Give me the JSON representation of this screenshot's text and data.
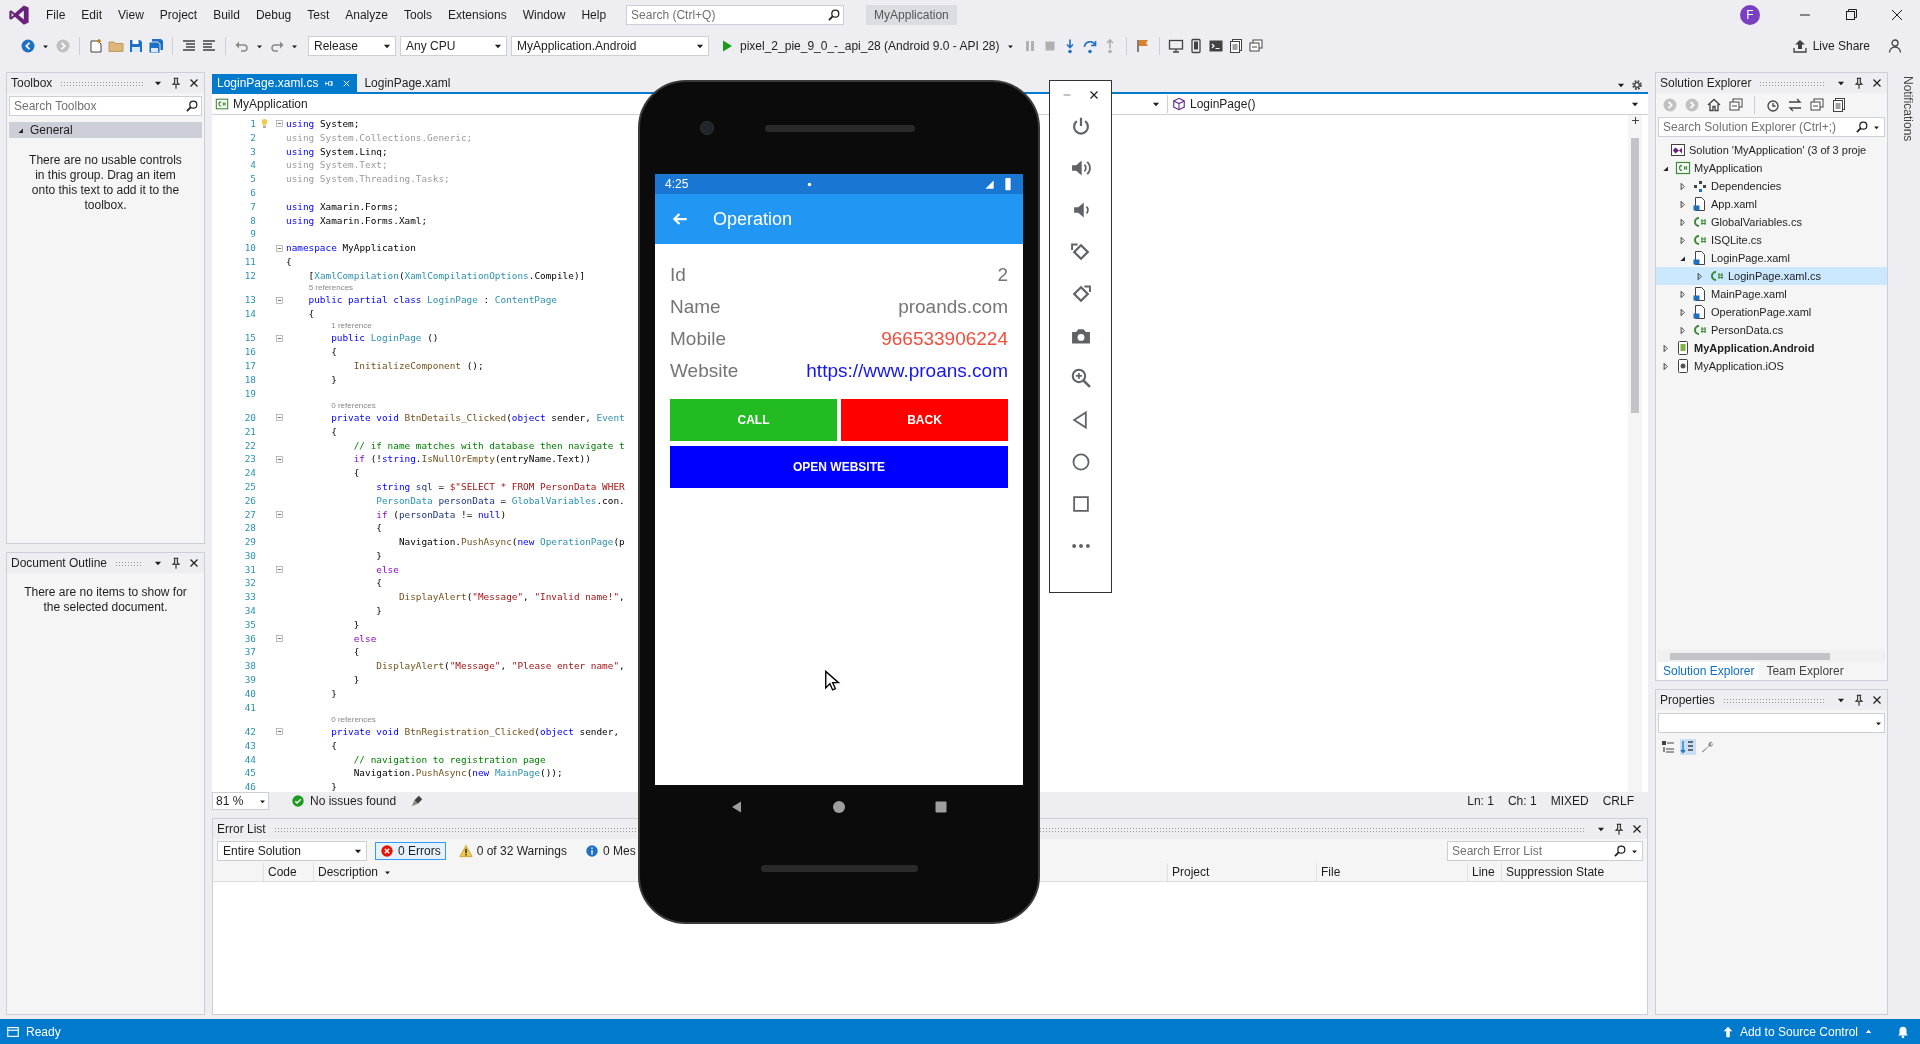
{
  "menu_bar": {
    "items": [
      "File",
      "Edit",
      "View",
      "Project",
      "Build",
      "Debug",
      "Test",
      "Analyze",
      "Tools",
      "Extensions",
      "Window",
      "Help"
    ],
    "search": {
      "placeholder": "Search (Ctrl+Q)"
    },
    "solution_name": "MyApplication",
    "avatar": "F"
  },
  "toolbar": {
    "configuration": "Release",
    "platform": "Any CPU",
    "startup_project": "MyApplication.Android",
    "run_target": "pixel_2_pie_9_0_-_api_28 (Android 9.0 - API 28)",
    "live_share": "Live Share"
  },
  "toolbox": {
    "title": "Toolbox",
    "search": {
      "placeholder": "Search Toolbox"
    },
    "groups": [
      {
        "label": "General",
        "expanded": true
      }
    ],
    "message": "There are no usable controls in this group. Drag an item onto this text to add it to the toolbox."
  },
  "document_outline": {
    "title": "Document Outline",
    "message": "There are no items to show for the selected document."
  },
  "editor": {
    "tabs": [
      {
        "label": "LoginPage.xaml.cs",
        "selected": true
      },
      {
        "label": "LoginPage.xaml",
        "selected": false
      }
    ],
    "project": "MyApplication",
    "member": "LoginPage()",
    "lines": [
      {
        "kind": "code",
        "number": "1",
        "fold": true,
        "hint": true,
        "tokens": [
          {
            "kind": "kw",
            "text": "using"
          },
          {
            "kind": "p",
            "text": " System;"
          }
        ]
      },
      {
        "kind": "code",
        "number": "2",
        "fold": false,
        "hint": false,
        "tokens": [
          {
            "kind": "fd",
            "text": "using System.Collections.Generic;"
          }
        ]
      },
      {
        "kind": "code",
        "number": "3",
        "fold": false,
        "hint": false,
        "tokens": [
          {
            "kind": "kw",
            "text": "using"
          },
          {
            "kind": "p",
            "text": " System.Linq;"
          }
        ]
      },
      {
        "kind": "code",
        "number": "4",
        "fold": false,
        "hint": false,
        "tokens": [
          {
            "kind": "fd",
            "text": "using System.Text;"
          }
        ]
      },
      {
        "kind": "code",
        "number": "5",
        "fold": false,
        "hint": false,
        "tokens": [
          {
            "kind": "fd",
            "text": "using System.Threading.Tasks;"
          }
        ]
      },
      {
        "kind": "code",
        "number": "6",
        "fold": false,
        "hint": false
      },
      {
        "kind": "code",
        "number": "7",
        "fold": false,
        "hint": false,
        "tokens": [
          {
            "kind": "kw",
            "text": "using"
          },
          {
            "kind": "p",
            "text": " Xamarin.Forms;"
          }
        ]
      },
      {
        "kind": "code",
        "number": "8",
        "fold": false,
        "hint": false,
        "tokens": [
          {
            "kind": "kw",
            "text": "using"
          },
          {
            "kind": "p",
            "text": " Xamarin.Forms.Xaml;"
          }
        ]
      },
      {
        "kind": "code",
        "number": "9",
        "fold": false,
        "hint": false
      },
      {
        "kind": "code",
        "number": "10",
        "fold": true,
        "hint": false,
        "tokens": [
          {
            "kind": "kw",
            "text": "namespace"
          },
          {
            "kind": "p",
            "text": " MyApplication"
          }
        ]
      },
      {
        "kind": "code",
        "number": "11",
        "fold": false,
        "hint": false,
        "tokens": [
          {
            "kind": "p",
            "text": "{"
          }
        ]
      },
      {
        "kind": "code",
        "number": "12",
        "fold": false,
        "hint": false,
        "tokens": [
          {
            "kind": "p",
            "text": "    ["
          },
          {
            "kind": "ty",
            "text": "XamlCompilation"
          },
          {
            "kind": "p",
            "text": "("
          },
          {
            "kind": "ty",
            "text": "XamlCompilationOptions"
          },
          {
            "kind": "p",
            "text": ".Compile)]"
          }
        ]
      },
      {
        "kind": "lens",
        "text": "5 references"
      },
      {
        "kind": "code",
        "number": "13",
        "fold": true,
        "hint": false,
        "tokens": [
          {
            "kind": "kw",
            "text": "    public partial class"
          },
          {
            "kind": "ty",
            "text": " LoginPage"
          },
          {
            "kind": "p",
            "text": " : "
          },
          {
            "kind": "ty",
            "text": "ContentPage"
          }
        ]
      },
      {
        "kind": "code",
        "number": "14",
        "fold": false,
        "hint": false,
        "tokens": [
          {
            "kind": "p",
            "text": "    {"
          }
        ]
      },
      {
        "kind": "lens",
        "text": "1 reference"
      },
      {
        "kind": "code",
        "number": "15",
        "fold": true,
        "hint": false,
        "tokens": [
          {
            "kind": "kw",
            "text": "        public"
          },
          {
            "kind": "ty",
            "text": " LoginPage"
          },
          {
            "kind": "p",
            "text": " ()"
          }
        ]
      },
      {
        "kind": "code",
        "number": "16",
        "fold": false,
        "hint": false,
        "tokens": [
          {
            "kind": "p",
            "text": "        {"
          }
        ]
      },
      {
        "kind": "code",
        "number": "17",
        "fold": false,
        "hint": false,
        "tokens": [
          {
            "kind": "me",
            "text": "            InitializeComponent"
          },
          {
            "kind": "p",
            "text": " ();"
          }
        ]
      },
      {
        "kind": "code",
        "number": "18",
        "fold": false,
        "hint": false,
        "tokens": [
          {
            "kind": "p",
            "text": "        }"
          }
        ]
      },
      {
        "kind": "code",
        "number": "19",
        "fold": false,
        "hint": false
      },
      {
        "kind": "lens",
        "text": "0 references"
      },
      {
        "kind": "code",
        "number": "20",
        "fold": true,
        "hint": false,
        "tokens": [
          {
            "kind": "kw",
            "text": "        private void"
          },
          {
            "kind": "me",
            "text": " BtnDetails_Clicked"
          },
          {
            "kind": "p",
            "text": "("
          },
          {
            "kind": "kw",
            "text": "object"
          },
          {
            "kind": "p",
            "text": " sender, "
          },
          {
            "kind": "ty",
            "text": "Event"
          }
        ]
      },
      {
        "kind": "code",
        "number": "21",
        "fold": false,
        "hint": false,
        "tokens": [
          {
            "kind": "p",
            "text": "        {"
          }
        ]
      },
      {
        "kind": "code",
        "number": "22",
        "fold": false,
        "hint": false,
        "tokens": [
          {
            "kind": "cm",
            "text": "            // if name matches with database then navigate t"
          }
        ]
      },
      {
        "kind": "code",
        "number": "23",
        "fold": true,
        "hint": false,
        "tokens": [
          {
            "kind": "ct",
            "text": "            if"
          },
          {
            "kind": "p",
            "text": " (!"
          },
          {
            "kind": "kw",
            "text": "string"
          },
          {
            "kind": "p",
            "text": "."
          },
          {
            "kind": "me",
            "text": "IsNullOrEmpty"
          },
          {
            "kind": "p",
            "text": "(entryName.Text))"
          }
        ]
      },
      {
        "kind": "code",
        "number": "24",
        "fold": false,
        "hint": false,
        "tokens": [
          {
            "kind": "p",
            "text": "            {"
          }
        ]
      },
      {
        "kind": "code",
        "number": "25",
        "fold": false,
        "hint": false,
        "tokens": [
          {
            "kind": "kw",
            "text": "                string"
          },
          {
            "kind": "va",
            "text": " sql"
          },
          {
            "kind": "p",
            "text": " = "
          },
          {
            "kind": "st",
            "text": "$\"SELECT * FROM PersonData WHER"
          }
        ]
      },
      {
        "kind": "code",
        "number": "26",
        "fold": false,
        "hint": false,
        "tokens": [
          {
            "kind": "ty",
            "text": "                PersonData"
          },
          {
            "kind": "va",
            "text": " personData"
          },
          {
            "kind": "p",
            "text": " = "
          },
          {
            "kind": "ty",
            "text": "GlobalVariables"
          },
          {
            "kind": "p",
            "text": ".con."
          }
        ]
      },
      {
        "kind": "code",
        "number": "27",
        "fold": true,
        "hint": false,
        "tokens": [
          {
            "kind": "ct",
            "text": "                if"
          },
          {
            "kind": "p",
            "text": " ("
          },
          {
            "kind": "va",
            "text": "personData"
          },
          {
            "kind": "p",
            "text": " != "
          },
          {
            "kind": "kw",
            "text": "null"
          },
          {
            "kind": "p",
            "text": ")"
          }
        ]
      },
      {
        "kind": "code",
        "number": "28",
        "fold": false,
        "hint": false,
        "tokens": [
          {
            "kind": "p",
            "text": "                {"
          }
        ]
      },
      {
        "kind": "code",
        "number": "29",
        "fold": false,
        "hint": false,
        "tokens": [
          {
            "kind": "p",
            "text": "                    Navigation."
          },
          {
            "kind": "me",
            "text": "PushAsync"
          },
          {
            "kind": "p",
            "text": "("
          },
          {
            "kind": "kw",
            "text": "new"
          },
          {
            "kind": "ty",
            "text": " OperationPage"
          },
          {
            "kind": "p",
            "text": "(p"
          }
        ]
      },
      {
        "kind": "code",
        "number": "30",
        "fold": false,
        "hint": false,
        "tokens": [
          {
            "kind": "p",
            "text": "                }"
          }
        ]
      },
      {
        "kind": "code",
        "number": "31",
        "fold": true,
        "hint": false,
        "tokens": [
          {
            "kind": "ct",
            "text": "                else"
          }
        ]
      },
      {
        "kind": "code",
        "number": "32",
        "fold": false,
        "hint": false,
        "tokens": [
          {
            "kind": "p",
            "text": "                {"
          }
        ]
      },
      {
        "kind": "code",
        "number": "33",
        "fold": false,
        "hint": false,
        "tokens": [
          {
            "kind": "me",
            "text": "                    DisplayAlert"
          },
          {
            "kind": "p",
            "text": "("
          },
          {
            "kind": "st",
            "text": "\"Message\""
          },
          {
            "kind": "p",
            "text": ", "
          },
          {
            "kind": "st",
            "text": "\"Invalid name!\""
          },
          {
            "kind": "p",
            "text": ","
          }
        ]
      },
      {
        "kind": "code",
        "number": "34",
        "fold": false,
        "hint": false,
        "tokens": [
          {
            "kind": "p",
            "text": "                }"
          }
        ]
      },
      {
        "kind": "code",
        "number": "35",
        "fold": false,
        "hint": false,
        "tokens": [
          {
            "kind": "p",
            "text": "            }"
          }
        ]
      },
      {
        "kind": "code",
        "number": "36",
        "fold": true,
        "hint": false,
        "tokens": [
          {
            "kind": "ct",
            "text": "            else"
          }
        ]
      },
      {
        "kind": "code",
        "number": "37",
        "fold": false,
        "hint": false,
        "tokens": [
          {
            "kind": "p",
            "text": "            {"
          }
        ]
      },
      {
        "kind": "code",
        "number": "38",
        "fold": false,
        "hint": false,
        "tokens": [
          {
            "kind": "me",
            "text": "                DisplayAlert"
          },
          {
            "kind": "p",
            "text": "("
          },
          {
            "kind": "st",
            "text": "\"Message\""
          },
          {
            "kind": "p",
            "text": ", "
          },
          {
            "kind": "st",
            "text": "\"Please enter name\""
          },
          {
            "kind": "p",
            "text": ","
          }
        ]
      },
      {
        "kind": "code",
        "number": "39",
        "fold": false,
        "hint": false,
        "tokens": [
          {
            "kind": "p",
            "text": "            }"
          }
        ]
      },
      {
        "kind": "code",
        "number": "40",
        "fold": false,
        "hint": false,
        "tokens": [
          {
            "kind": "p",
            "text": "        }"
          }
        ]
      },
      {
        "kind": "code",
        "number": "41",
        "fold": false,
        "hint": false
      },
      {
        "kind": "lens",
        "text": "0 references"
      },
      {
        "kind": "code",
        "number": "42",
        "fold": true,
        "hint": false,
        "tokens": [
          {
            "kind": "kw",
            "text": "        private void"
          },
          {
            "kind": "me",
            "text": " BtnRegistration_Clicked"
          },
          {
            "kind": "p",
            "text": "("
          },
          {
            "kind": "kw",
            "text": "object"
          },
          {
            "kind": "p",
            "text": " sender,"
          }
        ]
      },
      {
        "kind": "code",
        "number": "43",
        "fold": false,
        "hint": false,
        "tokens": [
          {
            "kind": "p",
            "text": "        {"
          }
        ]
      },
      {
        "kind": "code",
        "number": "44",
        "fold": false,
        "hint": false,
        "tokens": [
          {
            "kind": "cm",
            "text": "            // navigation to registration page"
          }
        ]
      },
      {
        "kind": "code",
        "number": "45",
        "fold": false,
        "hint": false,
        "tokens": [
          {
            "kind": "p",
            "text": "            Navigation."
          },
          {
            "kind": "me",
            "text": "PushAsync"
          },
          {
            "kind": "p",
            "text": "("
          },
          {
            "kind": "kw",
            "text": "new"
          },
          {
            "kind": "ty",
            "text": " MainPage"
          },
          {
            "kind": "p",
            "text": "());"
          }
        ]
      },
      {
        "kind": "code",
        "number": "46",
        "fold": false,
        "hint": false,
        "tokens": [
          {
            "kind": "p",
            "text": "        }"
          }
        ]
      }
    ],
    "status": {
      "zoom": "81 %",
      "issues": "No issues found",
      "line": "Ln: 1",
      "column": "Ch: 1",
      "whitespace": "MIXED",
      "line_endings": "CRLF"
    }
  },
  "error_list": {
    "title": "Error List",
    "scope": "Entire Solution",
    "filters": [
      {
        "label": "0 Errors",
        "kind": "error",
        "selected": true
      },
      {
        "label": "0 of 32 Warnings",
        "kind": "warning",
        "selected": false
      },
      {
        "label": "0 Mes",
        "kind": "message",
        "selected": false
      }
    ],
    "search": {
      "placeholder": "Search Error List"
    },
    "columns": [
      "Code",
      "Description",
      "Project",
      "File",
      "Line",
      "Suppression State"
    ]
  },
  "solution_explorer": {
    "title": "Solution Explorer",
    "search": {
      "placeholder": "Search Solution Explorer (Ctrl+;)"
    },
    "tree": [
      {
        "label": "Solution 'MyApplication' (3 of 3 proje",
        "kind": "solution",
        "selected": false,
        "children": [
          {
            "label": "MyApplication",
            "kind": "csproj",
            "expanded": true,
            "selected": false,
            "startup": false,
            "children": [
              {
                "label": "Dependencies",
                "kind": "deps",
                "expanded": false,
                "selected": false
              },
              {
                "label": "App.xaml",
                "kind": "xaml",
                "expanded": false,
                "selected": false
              },
              {
                "label": "GlobalVariables.cs",
                "kind": "cs",
                "expanded": false,
                "selected": false
              },
              {
                "label": "ISQLite.cs",
                "kind": "cs",
                "expanded": false,
                "selected": false
              },
              {
                "label": "LoginPage.xaml",
                "kind": "xaml",
                "expanded": true,
                "selected": false,
                "children": [
                  {
                    "label": "LoginPage.xaml.cs",
                    "kind": "cs",
                    "expanded": false,
                    "selected": true
                  }
                ]
              },
              {
                "label": "MainPage.xaml",
                "kind": "xaml",
                "expanded": false,
                "selected": false
              },
              {
                "label": "OperationPage.xaml",
                "kind": "xaml",
                "expanded": false,
                "selected": false
              },
              {
                "label": "PersonData.cs",
                "kind": "cs",
                "expanded": false,
                "selected": false
              }
            ]
          },
          {
            "label": "MyApplication.Android",
            "kind": "android",
            "expanded": false,
            "selected": false,
            "startup": true
          },
          {
            "label": "MyApplication.iOS",
            "kind": "ios",
            "expanded": false,
            "selected": false,
            "startup": false
          }
        ]
      }
    ],
    "tabs": [
      {
        "label": "Solution Explorer",
        "selected": true
      },
      {
        "label": "Team Explorer",
        "selected": false
      }
    ]
  },
  "properties": {
    "title": "Properties"
  },
  "notifications": {
    "label": "Notifications"
  },
  "status_bar": {
    "text": "Ready",
    "source_control": "Add to Source Control"
  },
  "emulator": {
    "screen": {
      "time": "4:25",
      "title": "Operation",
      "fields": [
        {
          "label": "Id",
          "value": "2",
          "kind": "plain"
        },
        {
          "label": "Name",
          "value": "proands.com",
          "kind": "plain"
        },
        {
          "label": "Mobile",
          "value": "966533906224",
          "kind": "phone"
        },
        {
          "label": "Website",
          "value": "https://www.proans.com",
          "kind": "link"
        }
      ],
      "buttons": [
        {
          "label": "CALL",
          "color": "#22bb22"
        },
        {
          "label": "BACK",
          "color": "#ff0000"
        },
        {
          "label": "OPEN WEBSITE",
          "color": "#0000ff"
        }
      ]
    }
  }
}
